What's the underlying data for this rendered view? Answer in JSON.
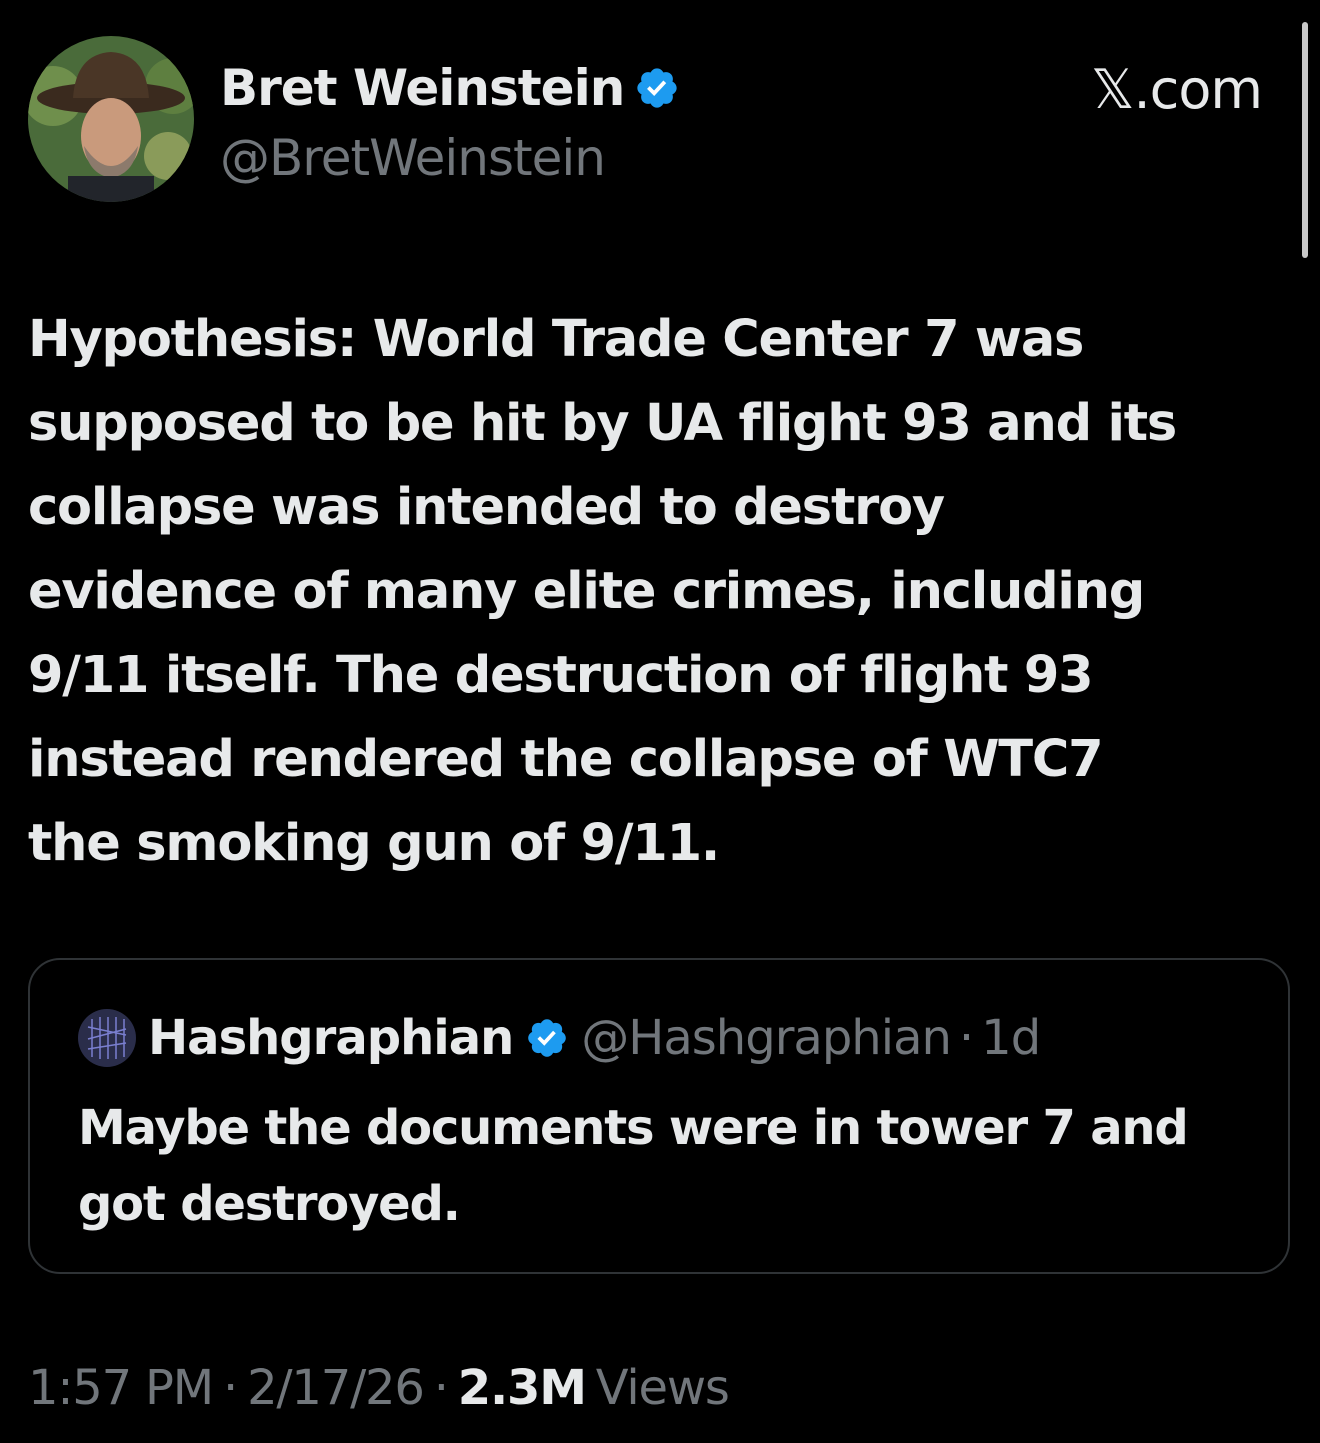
{
  "author": {
    "name": "Bret Weinstein",
    "handle": "@BretWeinstein",
    "verified": true
  },
  "site_label": "𝕏.com",
  "tweet": {
    "text": "Hypothesis: World Trade Center 7 was\nsupposed to be hit by UA flight 93 and its\ncollapse was intended to destroy\nevidence of many elite crimes, including\n9/11 itself. The destruction of flight 93\ninstead rendered the collapse of WTC7\nthe smoking gun of 9/11."
  },
  "quote": {
    "name": "Hashgraphian",
    "handle": "@Hashgraphian",
    "separator": "·",
    "age": "1d",
    "verified": true,
    "text": "Maybe the documents were in tower 7 and\ngot destroyed."
  },
  "footer": {
    "time": "1:57 PM",
    "separator": "·",
    "date": "2/17/26",
    "views_count": "2.3M",
    "views_label": "Views"
  },
  "colors": {
    "background": "#000000",
    "primary_text": "#e7e9ea",
    "secondary_text": "#71767b",
    "verified_badge": "#1d9bf0",
    "border": "#2f3336"
  }
}
